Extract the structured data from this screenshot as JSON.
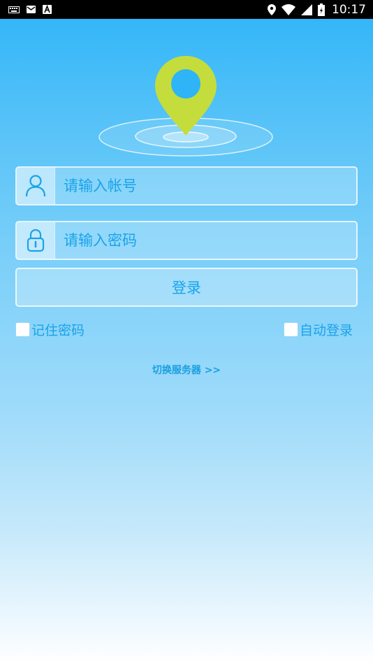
{
  "status_bar": {
    "time": "10:17",
    "left_icons": [
      "keyboard-icon",
      "message-icon",
      "a-icon"
    ],
    "right_icons": [
      "location-icon",
      "wifi-icon",
      "signal-icon",
      "battery-icon"
    ]
  },
  "logo": {
    "icon": "location-pin-icon",
    "pin_color": "#c4dd3c"
  },
  "login": {
    "username_placeholder": "请输入帐号",
    "password_placeholder": "请输入密码",
    "login_button": "登录",
    "remember_password": "记住密码",
    "auto_login": "自动登录",
    "switch_server": "切换服务器 >>"
  },
  "colors": {
    "accent": "#1aa3e8",
    "statusbar": "#000000"
  }
}
